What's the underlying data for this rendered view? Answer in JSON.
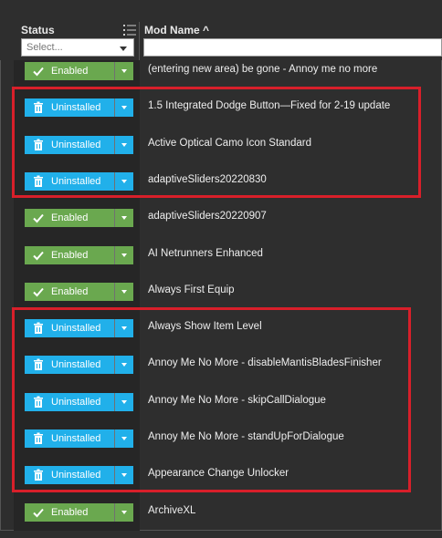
{
  "header": {
    "status_label": "Status",
    "mod_name_label": "Mod Name ^",
    "status_filter_placeholder": "Select...",
    "mod_filter_value": ""
  },
  "colors": {
    "enabled": "#6aa84f",
    "uninstalled": "#21b0ea",
    "highlight": "#d81f2a"
  },
  "rows": [
    {
      "status": "Enabled",
      "name": "(entering new area) be gone - Annoy me no more"
    },
    {
      "status": "Uninstalled",
      "name": "1.5 Integrated Dodge Button—Fixed for 2-19 update"
    },
    {
      "status": "Uninstalled",
      "name": "Active Optical Camo Icon Standard"
    },
    {
      "status": "Uninstalled",
      "name": "adaptiveSliders20220830"
    },
    {
      "status": "Enabled",
      "name": "adaptiveSliders20220907"
    },
    {
      "status": "Enabled",
      "name": "AI Netrunners Enhanced"
    },
    {
      "status": "Enabled",
      "name": "Always First Equip"
    },
    {
      "status": "Uninstalled",
      "name": "Always Show Item Level"
    },
    {
      "status": "Uninstalled",
      "name": "Annoy Me No More - disableMantisBladesFinisher"
    },
    {
      "status": "Uninstalled",
      "name": "Annoy Me No More - skipCallDialogue"
    },
    {
      "status": "Uninstalled",
      "name": "Annoy Me No More - standUpForDialogue"
    },
    {
      "status": "Uninstalled",
      "name": "Appearance Change Unlocker"
    },
    {
      "status": "Enabled",
      "name": "ArchiveXL"
    }
  ]
}
